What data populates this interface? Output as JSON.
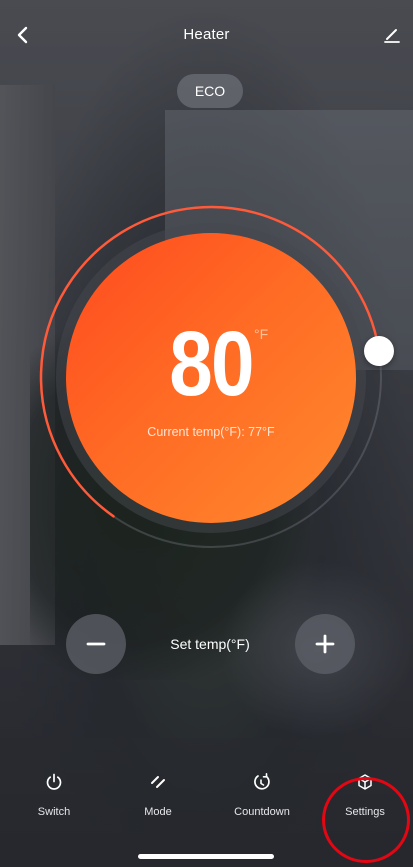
{
  "header": {
    "title": "Heater"
  },
  "mode_pill": "ECO",
  "dial": {
    "set_value": "80",
    "unit": "°F",
    "current_temp": "Current temp(°F): 77°F",
    "level_fraction": 0.78
  },
  "controls": {
    "set_temp_label": "Set temp(°F)"
  },
  "nav": {
    "switch": "Switch",
    "mode": "Mode",
    "countdown": "Countdown",
    "settings": "Settings"
  },
  "colors": {
    "accent": "#ff5a22",
    "highlight_ring": "#e30613"
  }
}
